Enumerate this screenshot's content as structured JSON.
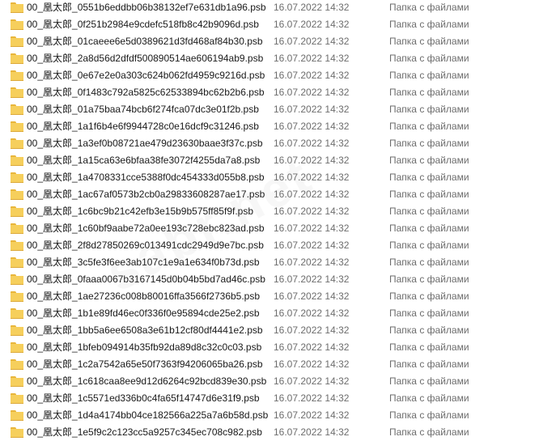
{
  "files": [
    {
      "name": "00_凰太郎_0551b6eddbb06b38132ef7e631db1a96.psb",
      "date": "16.07.2022 14:32",
      "type": "Папка с файлами"
    },
    {
      "name": "00_凰太郎_0f251b2984e9cdefc518fb8c42b9096d.psb",
      "date": "16.07.2022 14:32",
      "type": "Папка с файлами"
    },
    {
      "name": "00_凰太郎_01caeee6e5d0389621d3fd468af84b30.psb",
      "date": "16.07.2022 14:32",
      "type": "Папка с файлами"
    },
    {
      "name": "00_凰太郎_2a8d56d2dfdf500890514ae606194ab9.psb",
      "date": "16.07.2022 14:32",
      "type": "Папка с файлами"
    },
    {
      "name": "00_凰太郎_0e67e2e0a303c624b062fd4959c9216d.psb",
      "date": "16.07.2022 14:32",
      "type": "Папка с файлами"
    },
    {
      "name": "00_凰太郎_0f1483c792a5825c62533894bc62b2b6.psb",
      "date": "16.07.2022 14:32",
      "type": "Папка с файлами"
    },
    {
      "name": "00_凰太郎_01a75baa74bcb6f274fca07dc3e01f2b.psb",
      "date": "16.07.2022 14:32",
      "type": "Папка с файлами"
    },
    {
      "name": "00_凰太郎_1a1f6b4e6f9944728c0e16dcf9c31246.psb",
      "date": "16.07.2022 14:32",
      "type": "Папка с файлами"
    },
    {
      "name": "00_凰太郎_1a3ef0b08721ae479d23630baae3f37c.psb",
      "date": "16.07.2022 14:32",
      "type": "Папка с файлами"
    },
    {
      "name": "00_凰太郎_1a15ca63e6bfaa38fe3072f4255da7a8.psb",
      "date": "16.07.2022 14:32",
      "type": "Папка с файлами"
    },
    {
      "name": "00_凰太郎_1a4708331cce5388f0dc454333d055b8.psb",
      "date": "16.07.2022 14:32",
      "type": "Папка с файлами"
    },
    {
      "name": "00_凰太郎_1ac67af0573b2cb0a29833608287ae17.psb",
      "date": "16.07.2022 14:32",
      "type": "Папка с файлами"
    },
    {
      "name": "00_凰太郎_1c6bc9b21c42efb3e15b9b575ff85f9f.psb",
      "date": "16.07.2022 14:32",
      "type": "Папка с файлами"
    },
    {
      "name": "00_凰太郎_1c60bf9aabe72a0ee193c728ebc823ad.psb",
      "date": "16.07.2022 14:32",
      "type": "Папка с файлами"
    },
    {
      "name": "00_凰太郎_2f8d27850269c013491cdc2949d9e7bc.psb",
      "date": "16.07.2022 14:32",
      "type": "Папка с файлами"
    },
    {
      "name": "00_凰太郎_3c5fe3f6ee3ab107c1e9a1e634f0b73d.psb",
      "date": "16.07.2022 14:32",
      "type": "Папка с файлами"
    },
    {
      "name": "00_凰太郎_0faaa0067b3167145d0b04b5bd7ad46c.psb",
      "date": "16.07.2022 14:32",
      "type": "Папка с файлами"
    },
    {
      "name": "00_凰太郎_1ae27236c008b80016ffa3566f2736b5.psb",
      "date": "16.07.2022 14:32",
      "type": "Папка с файлами"
    },
    {
      "name": "00_凰太郎_1b1e89fd46ec0f336f0e95894cde25e2.psb",
      "date": "16.07.2022 14:32",
      "type": "Папка с файлами"
    },
    {
      "name": "00_凰太郎_1bb5a6ee6508a3e61b12cf80df4441e2.psb",
      "date": "16.07.2022 14:32",
      "type": "Папка с файлами"
    },
    {
      "name": "00_凰太郎_1bfeb094914b35fb92da89d8c32c0c03.psb",
      "date": "16.07.2022 14:32",
      "type": "Папка с файлами"
    },
    {
      "name": "00_凰太郎_1c2a7542a65e50f7363f94206065ba26.psb",
      "date": "16.07.2022 14:32",
      "type": "Папка с файлами"
    },
    {
      "name": "00_凰太郎_1c618caa8ee9d12d6264c92bcd839e30.psb",
      "date": "16.07.2022 14:32",
      "type": "Папка с файлами"
    },
    {
      "name": "00_凰太郎_1c5571ed336b0c4fa65f14747d6e31f9.psb",
      "date": "16.07.2022 14:32",
      "type": "Папка с файлами"
    },
    {
      "name": "00_凰太郎_1d4a4174bb04ce182566a225a7a6b58d.psb",
      "date": "16.07.2022 14:32",
      "type": "Папка с файлами"
    },
    {
      "name": "00_凰太郎_1e5f9c2c123cc5a9257c345ec708c982.psb",
      "date": "16.07.2022 14:32",
      "type": "Папка с файлами"
    }
  ],
  "watermark": "sabr.net",
  "colors": {
    "folder_body": "#f6cf5c",
    "folder_tab": "#e8b53a",
    "name_text": "#1a1a1a",
    "meta_text": "#6d6d6d"
  },
  "icon": "folder-icon"
}
